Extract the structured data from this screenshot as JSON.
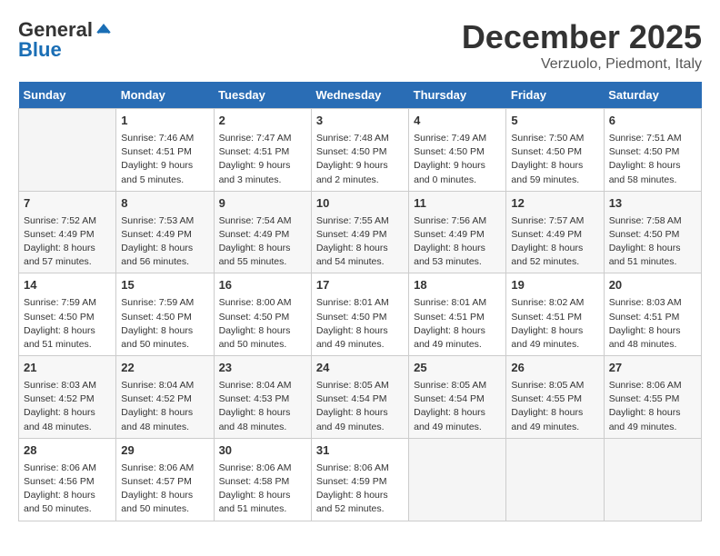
{
  "header": {
    "logo_general": "General",
    "logo_blue": "Blue",
    "month_title": "December 2025",
    "subtitle": "Verzuolo, Piedmont, Italy"
  },
  "days_of_week": [
    "Sunday",
    "Monday",
    "Tuesday",
    "Wednesday",
    "Thursday",
    "Friday",
    "Saturday"
  ],
  "weeks": [
    [
      {
        "day": "",
        "content": ""
      },
      {
        "day": "1",
        "content": "Sunrise: 7:46 AM\nSunset: 4:51 PM\nDaylight: 9 hours\nand 5 minutes."
      },
      {
        "day": "2",
        "content": "Sunrise: 7:47 AM\nSunset: 4:51 PM\nDaylight: 9 hours\nand 3 minutes."
      },
      {
        "day": "3",
        "content": "Sunrise: 7:48 AM\nSunset: 4:50 PM\nDaylight: 9 hours\nand 2 minutes."
      },
      {
        "day": "4",
        "content": "Sunrise: 7:49 AM\nSunset: 4:50 PM\nDaylight: 9 hours\nand 0 minutes."
      },
      {
        "day": "5",
        "content": "Sunrise: 7:50 AM\nSunset: 4:50 PM\nDaylight: 8 hours\nand 59 minutes."
      },
      {
        "day": "6",
        "content": "Sunrise: 7:51 AM\nSunset: 4:50 PM\nDaylight: 8 hours\nand 58 minutes."
      }
    ],
    [
      {
        "day": "7",
        "content": "Sunrise: 7:52 AM\nSunset: 4:49 PM\nDaylight: 8 hours\nand 57 minutes."
      },
      {
        "day": "8",
        "content": "Sunrise: 7:53 AM\nSunset: 4:49 PM\nDaylight: 8 hours\nand 56 minutes."
      },
      {
        "day": "9",
        "content": "Sunrise: 7:54 AM\nSunset: 4:49 PM\nDaylight: 8 hours\nand 55 minutes."
      },
      {
        "day": "10",
        "content": "Sunrise: 7:55 AM\nSunset: 4:49 PM\nDaylight: 8 hours\nand 54 minutes."
      },
      {
        "day": "11",
        "content": "Sunrise: 7:56 AM\nSunset: 4:49 PM\nDaylight: 8 hours\nand 53 minutes."
      },
      {
        "day": "12",
        "content": "Sunrise: 7:57 AM\nSunset: 4:49 PM\nDaylight: 8 hours\nand 52 minutes."
      },
      {
        "day": "13",
        "content": "Sunrise: 7:58 AM\nSunset: 4:50 PM\nDaylight: 8 hours\nand 51 minutes."
      }
    ],
    [
      {
        "day": "14",
        "content": "Sunrise: 7:59 AM\nSunset: 4:50 PM\nDaylight: 8 hours\nand 51 minutes."
      },
      {
        "day": "15",
        "content": "Sunrise: 7:59 AM\nSunset: 4:50 PM\nDaylight: 8 hours\nand 50 minutes."
      },
      {
        "day": "16",
        "content": "Sunrise: 8:00 AM\nSunset: 4:50 PM\nDaylight: 8 hours\nand 50 minutes."
      },
      {
        "day": "17",
        "content": "Sunrise: 8:01 AM\nSunset: 4:50 PM\nDaylight: 8 hours\nand 49 minutes."
      },
      {
        "day": "18",
        "content": "Sunrise: 8:01 AM\nSunset: 4:51 PM\nDaylight: 8 hours\nand 49 minutes."
      },
      {
        "day": "19",
        "content": "Sunrise: 8:02 AM\nSunset: 4:51 PM\nDaylight: 8 hours\nand 49 minutes."
      },
      {
        "day": "20",
        "content": "Sunrise: 8:03 AM\nSunset: 4:51 PM\nDaylight: 8 hours\nand 48 minutes."
      }
    ],
    [
      {
        "day": "21",
        "content": "Sunrise: 8:03 AM\nSunset: 4:52 PM\nDaylight: 8 hours\nand 48 minutes."
      },
      {
        "day": "22",
        "content": "Sunrise: 8:04 AM\nSunset: 4:52 PM\nDaylight: 8 hours\nand 48 minutes."
      },
      {
        "day": "23",
        "content": "Sunrise: 8:04 AM\nSunset: 4:53 PM\nDaylight: 8 hours\nand 48 minutes."
      },
      {
        "day": "24",
        "content": "Sunrise: 8:05 AM\nSunset: 4:54 PM\nDaylight: 8 hours\nand 49 minutes."
      },
      {
        "day": "25",
        "content": "Sunrise: 8:05 AM\nSunset: 4:54 PM\nDaylight: 8 hours\nand 49 minutes."
      },
      {
        "day": "26",
        "content": "Sunrise: 8:05 AM\nSunset: 4:55 PM\nDaylight: 8 hours\nand 49 minutes."
      },
      {
        "day": "27",
        "content": "Sunrise: 8:06 AM\nSunset: 4:55 PM\nDaylight: 8 hours\nand 49 minutes."
      }
    ],
    [
      {
        "day": "28",
        "content": "Sunrise: 8:06 AM\nSunset: 4:56 PM\nDaylight: 8 hours\nand 50 minutes."
      },
      {
        "day": "29",
        "content": "Sunrise: 8:06 AM\nSunset: 4:57 PM\nDaylight: 8 hours\nand 50 minutes."
      },
      {
        "day": "30",
        "content": "Sunrise: 8:06 AM\nSunset: 4:58 PM\nDaylight: 8 hours\nand 51 minutes."
      },
      {
        "day": "31",
        "content": "Sunrise: 8:06 AM\nSunset: 4:59 PM\nDaylight: 8 hours\nand 52 minutes."
      },
      {
        "day": "",
        "content": ""
      },
      {
        "day": "",
        "content": ""
      },
      {
        "day": "",
        "content": ""
      }
    ]
  ]
}
